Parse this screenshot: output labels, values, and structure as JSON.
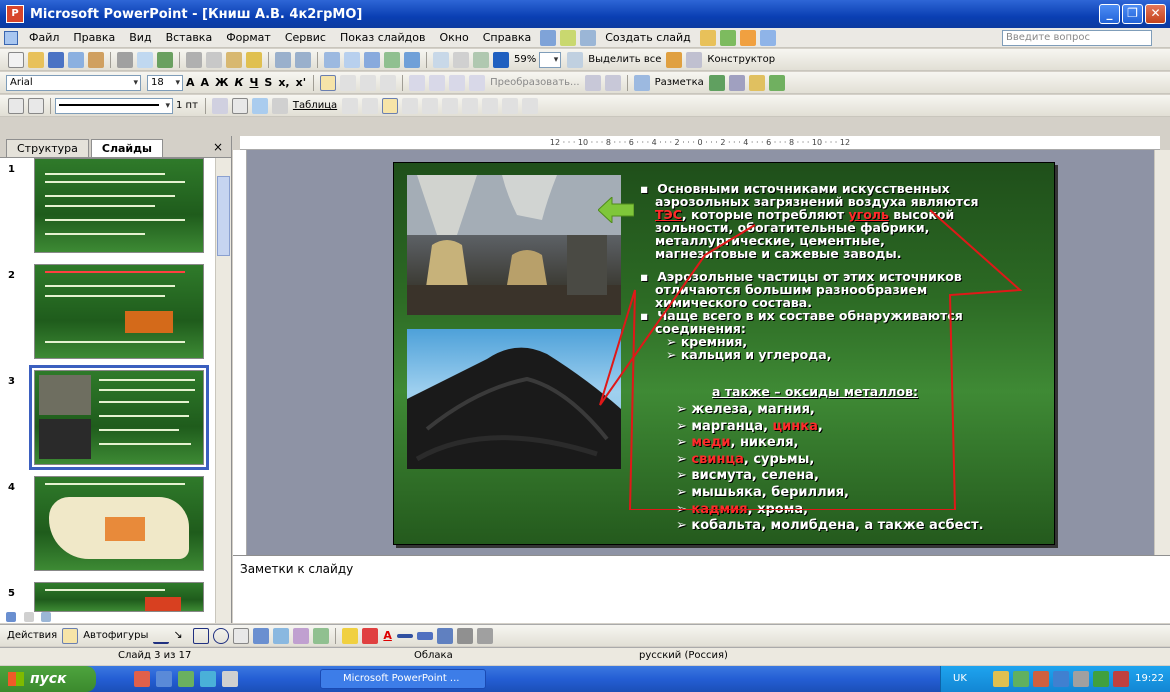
{
  "window": {
    "title": "Microsoft PowerPoint - [Книш А.В. 4к2грМО]",
    "app_icon_text": "P"
  },
  "menu": {
    "items": [
      "Файл",
      "Правка",
      "Вид",
      "Вставка",
      "Формат",
      "Сервис",
      "Показ слайдов",
      "Окно",
      "Справка"
    ],
    "create_slide": "Создать слайд",
    "ask_placeholder": "Введите вопрос"
  },
  "toolbar1": {
    "zoom": "59%",
    "select_all": "Выделить все",
    "designer": "Конструктор"
  },
  "toolbar2": {
    "font": "Arial",
    "size": "18",
    "convert": "Преобразовать...",
    "layout": "Разметка"
  },
  "toolbar3": {
    "line_weight": "1 пт",
    "table": "Таблица"
  },
  "tabs": {
    "structure": "Структура",
    "slides": "Слайды",
    "close": "×"
  },
  "thumbnails": [
    "1",
    "2",
    "3",
    "4",
    "5"
  ],
  "ruler_text": "12 · · · 10 · · · 8 · · · 6 · · · 4 · · · 2 · · · 0 · · · 2 · · · 4 · · · 6 · · · 8 · · · 10 · · · 12",
  "slide": {
    "p1_line1": "Основными источниками искусственных",
    "p1_line2": "аэрозольных загрязнений воздуха являются",
    "p1_tes": "ТЭС",
    "p1_mid": ", которые потребляют ",
    "p1_coal": "уголь",
    "p1_line3_end": " высокой",
    "p1_line4": "зольности, обогатительные фабрики,",
    "p1_line5": "металлургические, цементные,",
    "p1_line6": "магнезитовые и сажевые заводы.",
    "p2_line1": "Аэрозольные частицы от этих источников",
    "p2_line2": "отличаются большим разнообразием",
    "p2_line3": "химического состава.",
    "p3_line1": "Чаще всего в их составе обнаруживаются",
    "p3_line2": "соединения:",
    "comp1": "кремния,",
    "comp2": "кальция и углерода,",
    "oxides": "а также – оксиды металлов:",
    "m1": "железа, магния,",
    "m2_a": "марганца, ",
    "m2_b": "цинка",
    "m2_c": ",",
    "m3_a": "меди",
    "m3_b": ", никеля,",
    "m4_a": "свинца",
    "m4_b": ", сурьмы,",
    "m5": "висмута, селена,",
    "m6": "мышьяка, бериллия,",
    "m7_a": "кадмия",
    "m7_b": ", хрома,",
    "m8": "кобальта, молибдена, а также асбест."
  },
  "notes": "Заметки к слайду",
  "drawbar": {
    "actions": "Действия",
    "autoshapes": "Автофигуры"
  },
  "status": {
    "slide": "Слайд 3 из 17",
    "design": "Облака",
    "lang": "русский (Россия)"
  },
  "taskbar": {
    "start": "пуск",
    "app": "Microsoft PowerPoint ...",
    "lang": "UK",
    "time": "19:22"
  },
  "colors": {
    "accent_red": "#ff2a2a",
    "slide_green": "#2c6a24",
    "xp_blue": "#245ed4"
  }
}
